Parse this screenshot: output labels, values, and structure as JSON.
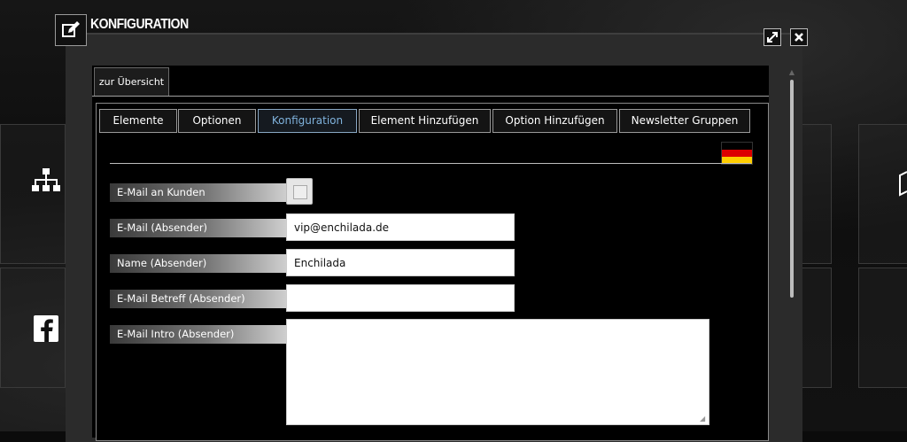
{
  "window": {
    "title": "KONFIGURATION",
    "title_icon": "edit-icon",
    "maximize_icon": "expand-icon",
    "close_icon": "close-icon"
  },
  "breadcrumb": {
    "back_label": "zur Übersicht"
  },
  "tabs": [
    {
      "label": "Elemente",
      "active": false
    },
    {
      "label": "Optionen",
      "active": false
    },
    {
      "label": "Konfiguration",
      "active": true
    },
    {
      "label": "Element Hinzufügen",
      "active": false
    },
    {
      "label": "Option Hinzufügen",
      "active": false
    },
    {
      "label": "Newsletter Gruppen",
      "active": false
    }
  ],
  "language": {
    "flag_icon": "german-flag-icon",
    "colors": [
      "#000000",
      "#dd0000",
      "#ffce00"
    ]
  },
  "form": {
    "email_customer_label": "E-Mail an Kunden",
    "email_customer_checked": false,
    "email_sender_label": "E-Mail (Absender)",
    "email_sender_value": "vip@enchilada.de",
    "name_sender_label": "Name (Absender)",
    "name_sender_value": "Enchilada",
    "subject_label": "E-Mail Betreff (Absender)",
    "subject_value": "",
    "intro_label": "E-Mail Intro (Absender)",
    "intro_value": ""
  },
  "background_icons": {
    "left_top": "sitemap-icon",
    "left_bottom": "facebook-icon"
  },
  "colors": {
    "active_tab": "#7fb2dc",
    "window_frame": "#2b2b2b",
    "panel_bg": "#000000"
  }
}
